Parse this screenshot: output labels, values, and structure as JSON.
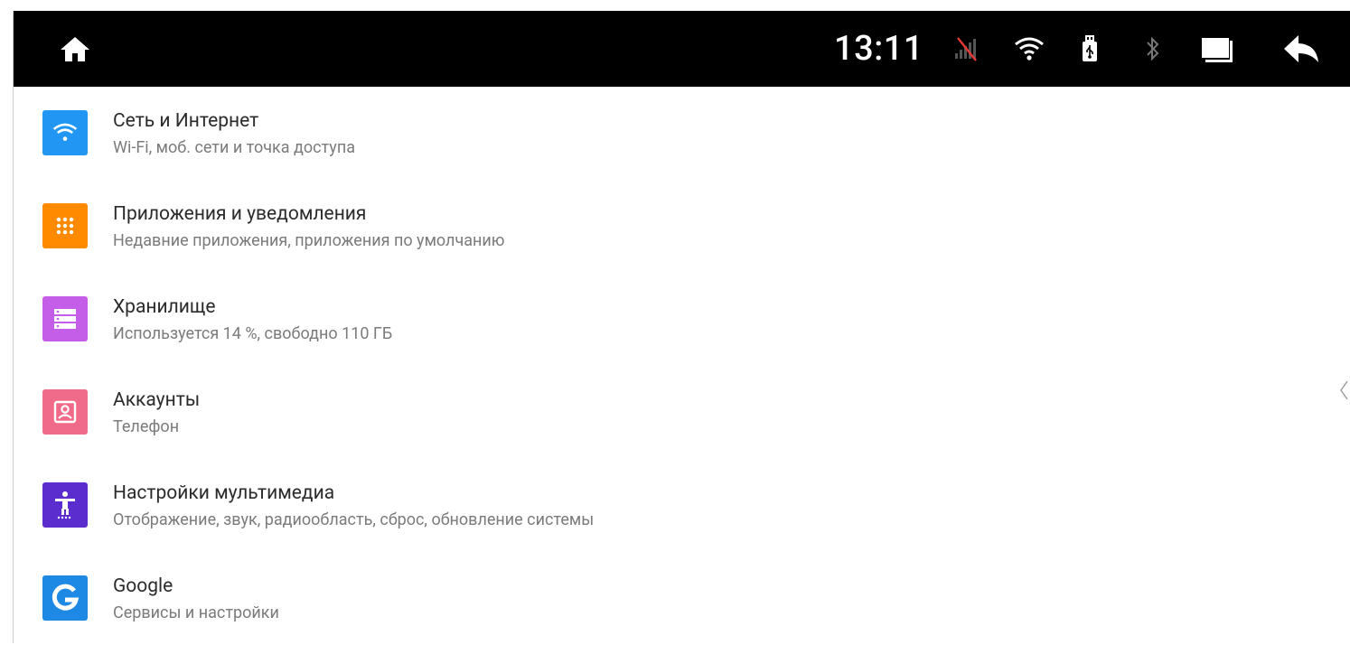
{
  "status_bar": {
    "time": "13:11",
    "icons": [
      "home-icon",
      "no-signal-icon",
      "wifi-icon",
      "usb-icon",
      "bluetooth-icon",
      "window-icon",
      "back-icon"
    ],
    "colors": {
      "background": "#000000",
      "foreground": "#ffffff",
      "no_signal_slash": "#e53935"
    }
  },
  "settings": {
    "items": [
      {
        "title": "Сеть и Интернет",
        "subtitle": "Wi-Fi, моб. сети и точка доступа",
        "icon": "wifi-icon",
        "color": "#2196f3"
      },
      {
        "title": "Приложения и уведомления",
        "subtitle": "Недавние приложения, приложения по умолчанию",
        "icon": "apps-grid-icon",
        "color": "#ff8a00"
      },
      {
        "title": "Хранилище",
        "subtitle": "Используется 14 %, свободно 110 ГБ",
        "icon": "storage-icon",
        "color": "#c45ee8"
      },
      {
        "title": "Аккаунты",
        "subtitle": "Телефон",
        "icon": "account-icon",
        "color": "#f06b8a"
      },
      {
        "title": "Настройки мультимедиа",
        "subtitle": "Отображение, звук, радиообласть, сброс, обновление системы",
        "icon": "accessibility-icon",
        "color": "#5b2dcf"
      },
      {
        "title": "Google",
        "subtitle": "Сервисы и настройки",
        "icon": "google-icon",
        "color": "#1e88e5"
      }
    ]
  }
}
